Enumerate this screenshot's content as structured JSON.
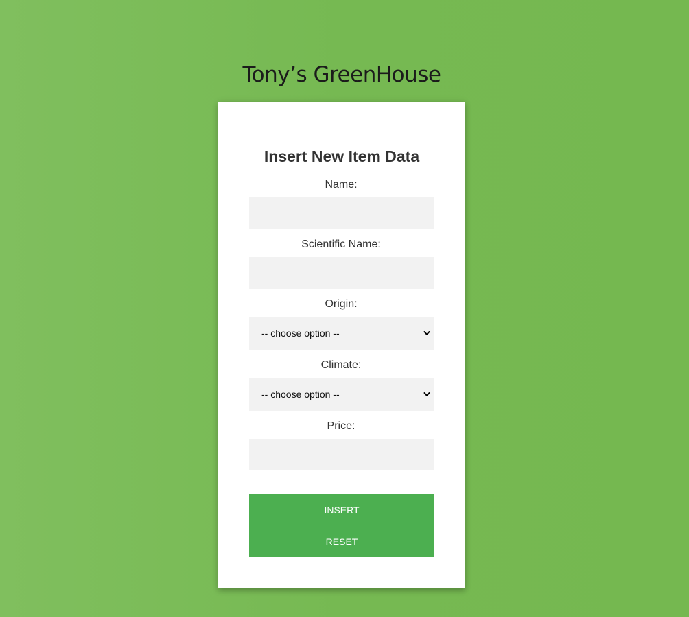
{
  "site": {
    "title": "Tony’s GreenHouse"
  },
  "form": {
    "title": "Insert New Item Data",
    "fields": {
      "name": {
        "label": "Name:",
        "value": "",
        "placeholder": ""
      },
      "scientific_name": {
        "label": "Scientific Name:",
        "value": "",
        "placeholder": ""
      },
      "origin": {
        "label": "Origin:",
        "selected": "-- choose option --"
      },
      "climate": {
        "label": "Climate:",
        "selected": "-- choose option --"
      },
      "price": {
        "label": "Price:",
        "value": "",
        "placeholder": ""
      }
    },
    "buttons": {
      "insert": "INSERT",
      "reset": "RESET"
    }
  },
  "colors": {
    "background": "#78ba54",
    "card": "#ffffff",
    "input_bg": "#f2f2f2",
    "button": "#4caf50",
    "button_text": "#ffffff"
  },
  "icons": {
    "select_arrow": "chevron-down-icon"
  }
}
